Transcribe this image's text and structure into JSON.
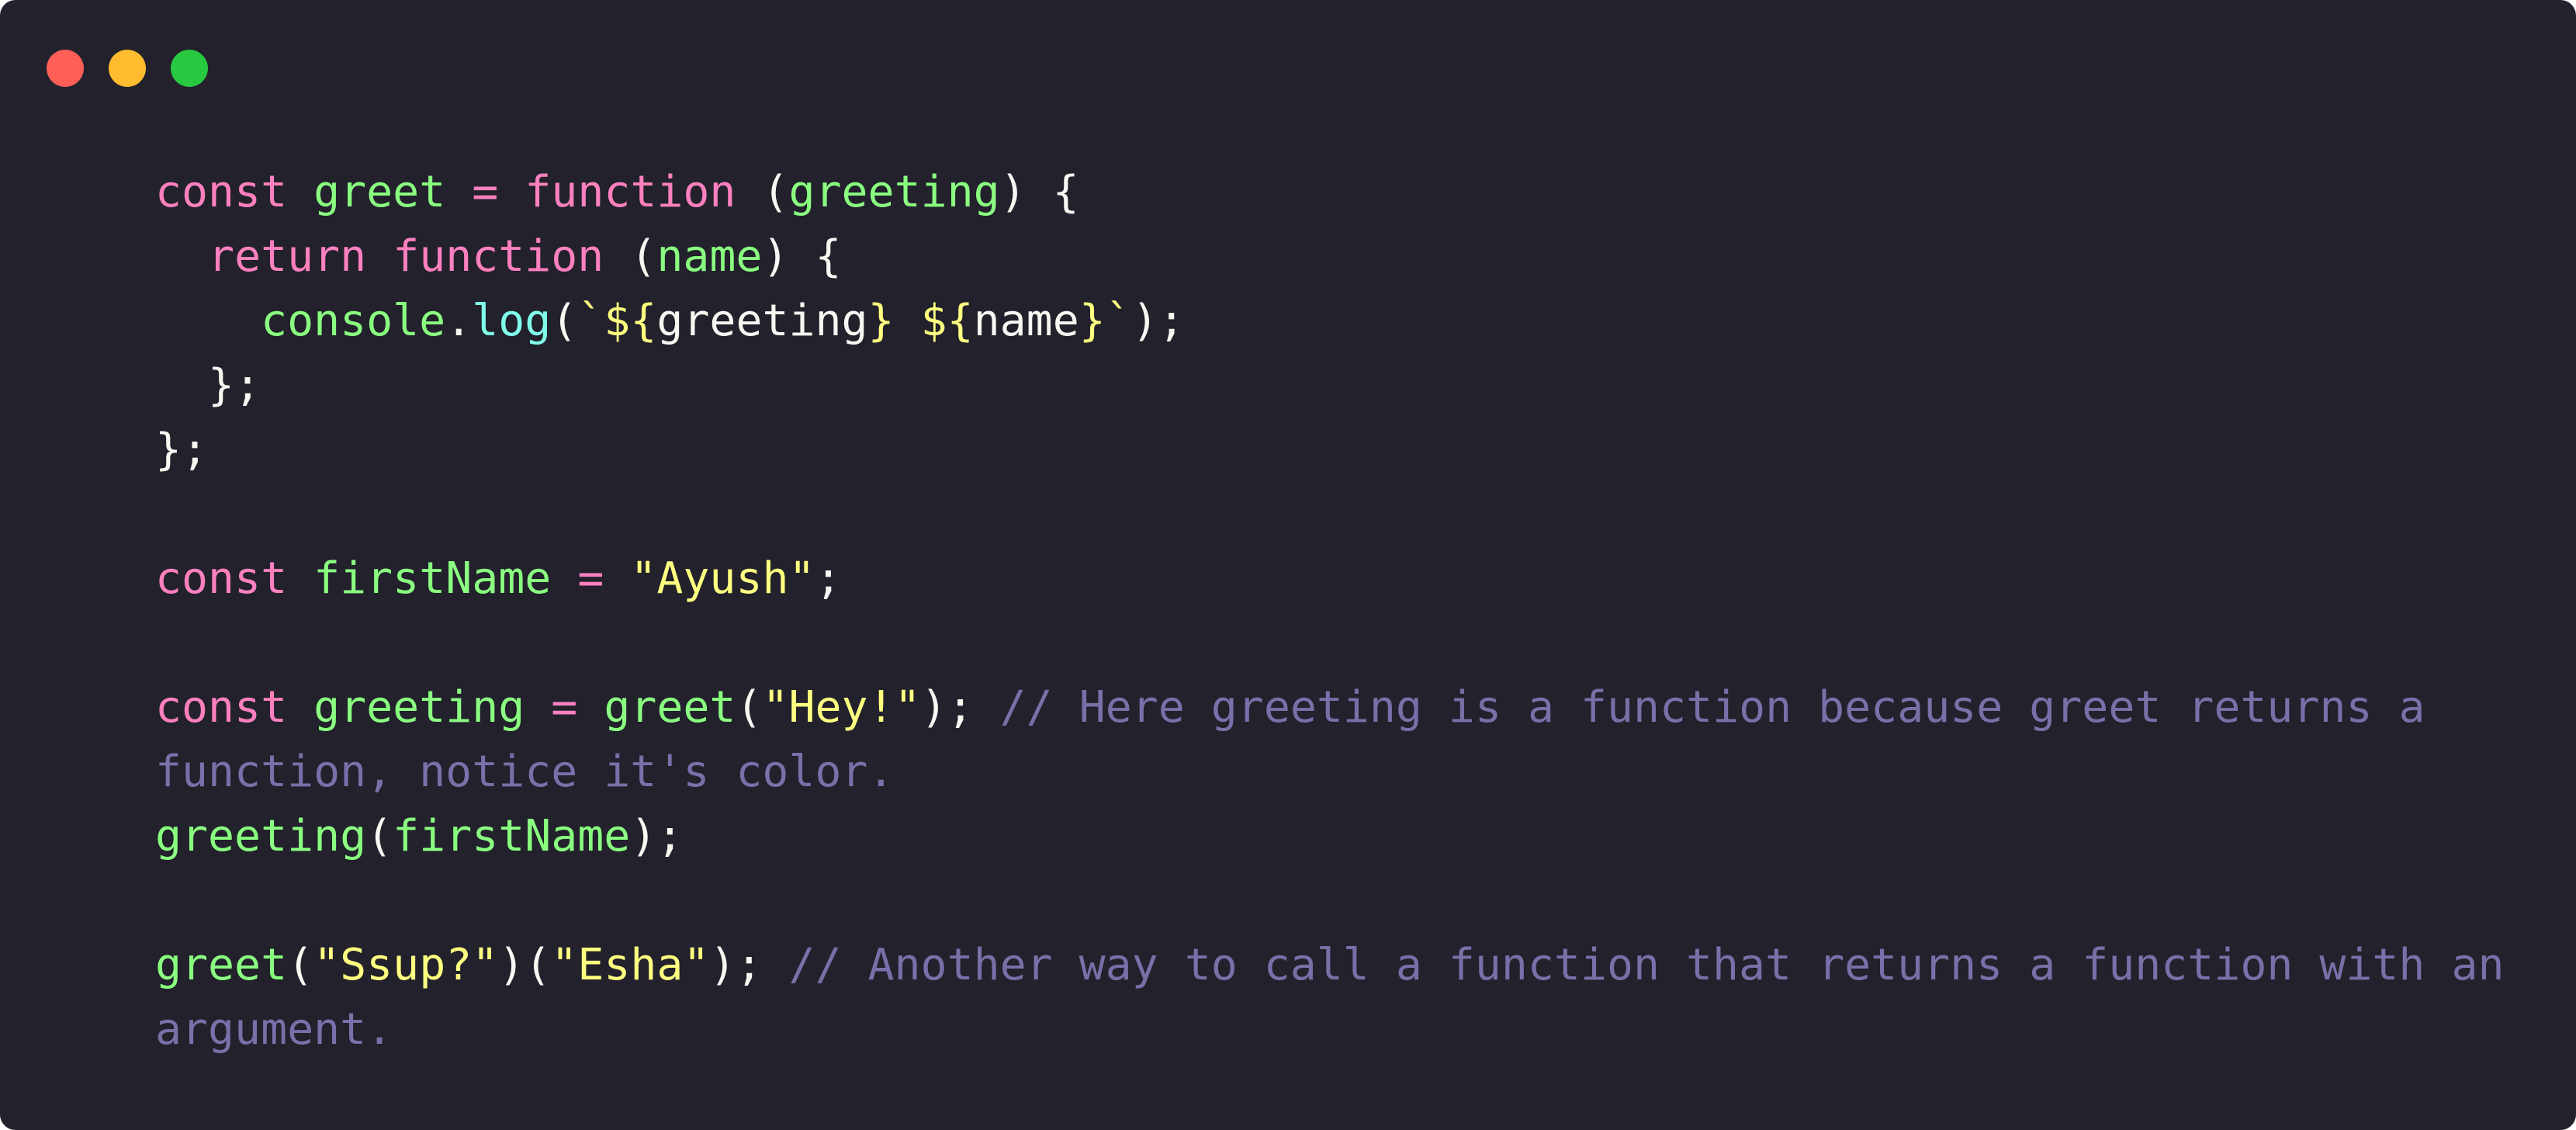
{
  "window": {
    "controls": {
      "close": "close",
      "minimize": "minimize",
      "maximize": "maximize"
    }
  },
  "code": {
    "lines": [
      [
        {
          "text": "const",
          "type": "keyword"
        },
        {
          "text": " ",
          "type": "plain"
        },
        {
          "text": "greet",
          "type": "function"
        },
        {
          "text": " ",
          "type": "plain"
        },
        {
          "text": "=",
          "type": "keyword"
        },
        {
          "text": " ",
          "type": "plain"
        },
        {
          "text": "function",
          "type": "keyword"
        },
        {
          "text": " (",
          "type": "plain"
        },
        {
          "text": "greeting",
          "type": "function"
        },
        {
          "text": ") {",
          "type": "plain"
        }
      ],
      [
        {
          "text": "  ",
          "type": "plain"
        },
        {
          "text": "return",
          "type": "keyword"
        },
        {
          "text": " ",
          "type": "plain"
        },
        {
          "text": "function",
          "type": "keyword"
        },
        {
          "text": " (",
          "type": "plain"
        },
        {
          "text": "name",
          "type": "function"
        },
        {
          "text": ") {",
          "type": "plain"
        }
      ],
      [
        {
          "text": "    ",
          "type": "plain"
        },
        {
          "text": "console",
          "type": "function"
        },
        {
          "text": ".",
          "type": "plain"
        },
        {
          "text": "log",
          "type": "property"
        },
        {
          "text": "(",
          "type": "plain"
        },
        {
          "text": "`${",
          "type": "template"
        },
        {
          "text": "greeting",
          "type": "plain"
        },
        {
          "text": "}",
          "type": "template"
        },
        {
          "text": " ",
          "type": "plain"
        },
        {
          "text": "${",
          "type": "template"
        },
        {
          "text": "name",
          "type": "plain"
        },
        {
          "text": "}`",
          "type": "template"
        },
        {
          "text": ");",
          "type": "plain"
        }
      ],
      [
        {
          "text": "  };",
          "type": "plain"
        }
      ],
      [
        {
          "text": "};",
          "type": "plain"
        }
      ],
      [],
      [
        {
          "text": "const",
          "type": "keyword"
        },
        {
          "text": " ",
          "type": "plain"
        },
        {
          "text": "firstName",
          "type": "function"
        },
        {
          "text": " ",
          "type": "plain"
        },
        {
          "text": "=",
          "type": "keyword"
        },
        {
          "text": " ",
          "type": "plain"
        },
        {
          "text": "\"Ayush\"",
          "type": "string"
        },
        {
          "text": ";",
          "type": "plain"
        }
      ],
      [],
      [
        {
          "text": "const",
          "type": "keyword"
        },
        {
          "text": " ",
          "type": "plain"
        },
        {
          "text": "greeting",
          "type": "function"
        },
        {
          "text": " ",
          "type": "plain"
        },
        {
          "text": "=",
          "type": "keyword"
        },
        {
          "text": " ",
          "type": "plain"
        },
        {
          "text": "greet",
          "type": "function"
        },
        {
          "text": "(",
          "type": "plain"
        },
        {
          "text": "\"Hey!\"",
          "type": "string"
        },
        {
          "text": "); ",
          "type": "plain"
        },
        {
          "text": "// Here greeting is a function because greet returns a",
          "type": "comment"
        }
      ],
      [
        {
          "text": "function, notice it's color.",
          "type": "comment"
        }
      ],
      [
        {
          "text": "greeting",
          "type": "function"
        },
        {
          "text": "(",
          "type": "plain"
        },
        {
          "text": "firstName",
          "type": "function"
        },
        {
          "text": ");",
          "type": "plain"
        }
      ],
      [],
      [
        {
          "text": "greet",
          "type": "function"
        },
        {
          "text": "(",
          "type": "plain"
        },
        {
          "text": "\"Ssup?\"",
          "type": "string"
        },
        {
          "text": ")(",
          "type": "plain"
        },
        {
          "text": "\"Esha\"",
          "type": "string"
        },
        {
          "text": "); ",
          "type": "plain"
        },
        {
          "text": "// Another way to call a function that returns a function with an",
          "type": "comment"
        }
      ],
      [
        {
          "text": "argument.",
          "type": "comment"
        }
      ]
    ]
  }
}
